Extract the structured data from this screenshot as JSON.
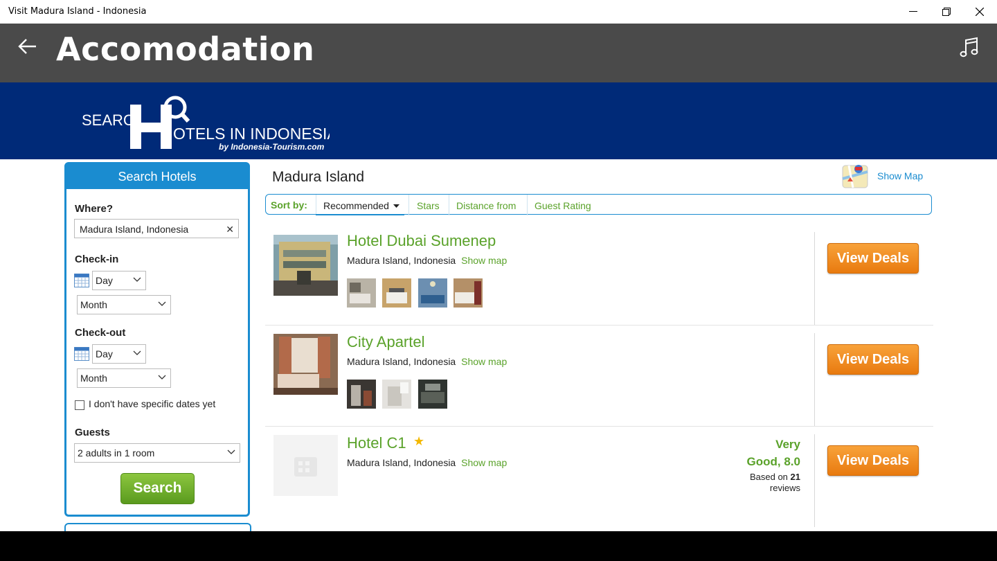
{
  "window": {
    "title": "Visit Madura Island - Indonesia",
    "minimize": "—",
    "restore": "❐",
    "close": "✕"
  },
  "appbar": {
    "title": "Accomodation"
  },
  "banner": {
    "logo_line1": "SEARC",
    "logo_line2": "OTELS IN INDONESIA",
    "logo_line3": "by Indonesia-Tourism.com"
  },
  "search": {
    "header": "Search Hotels",
    "where_label": "Where?",
    "where_value": "Madura Island, Indonesia",
    "checkin_label": "Check-in",
    "checkout_label": "Check-out",
    "day_option": "Day",
    "month_option": "Month",
    "no_dates_label": "I don't have specific dates yet",
    "guests_label": "Guests",
    "guests_value": "2 adults in 1 room",
    "button": "Search"
  },
  "results": {
    "location": "Madura Island",
    "show_map": "Show Map",
    "sort_label": "Sort by:",
    "sort_options": [
      "Recommended",
      "Stars",
      "Distance from",
      "Guest Rating"
    ],
    "hotels": [
      {
        "name": "Hotel Dubai Sumenep",
        "address": "Madura Island, Indonesia",
        "show_map": "Show map",
        "deals": "View Deals"
      },
      {
        "name": "City Apartel",
        "address": "Madura Island, Indonesia",
        "show_map": "Show map",
        "deals": "View Deals"
      },
      {
        "name": "Hotel C1",
        "address": "Madura Island, Indonesia",
        "show_map": "Show map",
        "deals": "View Deals",
        "rating_line1": "Very",
        "rating_line2": "Good, 8.0",
        "reviews_prefix": "Based on",
        "reviews_count": "21",
        "reviews_suffix": "reviews"
      }
    ]
  },
  "colors": {
    "accent_blue": "#1a8cd0",
    "green": "#5aa22a",
    "orange": "#f39325",
    "banner": "#002a78",
    "appbar": "#4a4a4a"
  }
}
